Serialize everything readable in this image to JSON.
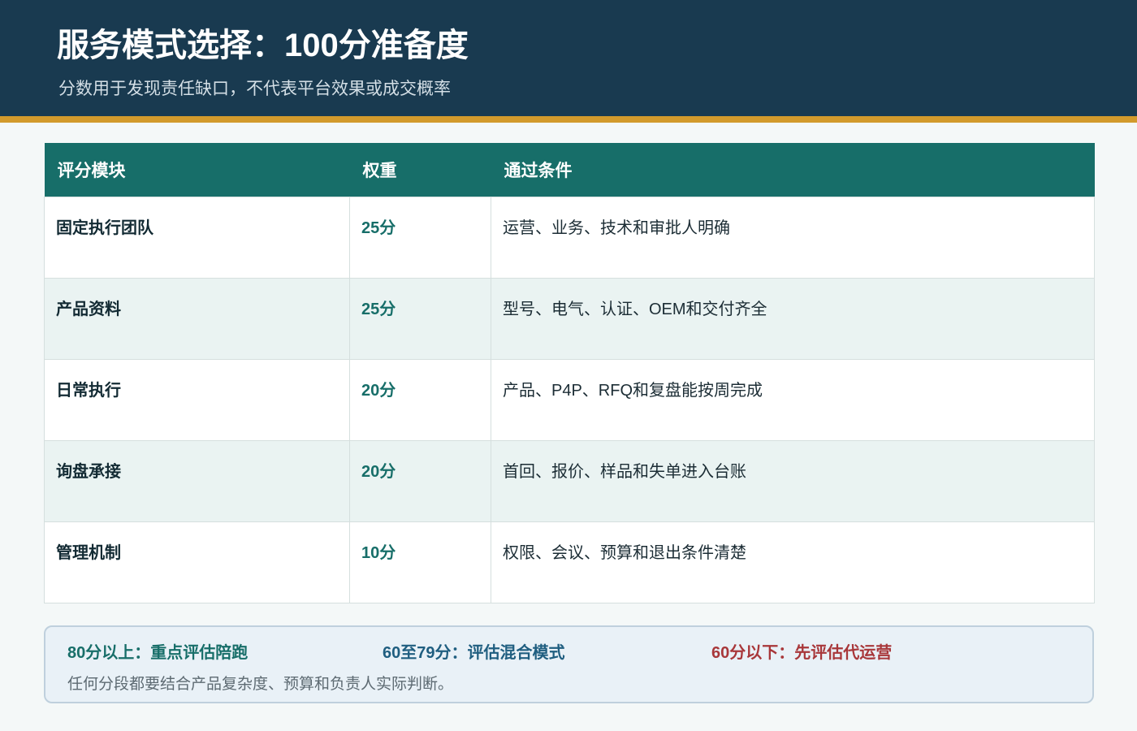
{
  "header": {
    "title": "服务模式选择：100分准备度",
    "subtitle": "分数用于发现责任缺口，不代表平台效果或成交概率"
  },
  "table": {
    "columns": [
      "评分模块",
      "权重",
      "通过条件"
    ],
    "rows": [
      {
        "module": "固定执行团队",
        "weight": "25分",
        "condition": "运营、业务、技术和审批人明确"
      },
      {
        "module": "产品资料",
        "weight": "25分",
        "condition": "型号、电气、认证、OEM和交付齐全"
      },
      {
        "module": "日常执行",
        "weight": "20分",
        "condition": "产品、P4P、RFQ和复盘能按周完成"
      },
      {
        "module": "询盘承接",
        "weight": "20分",
        "condition": "首回、报价、样品和失单进入台账"
      },
      {
        "module": "管理机制",
        "weight": "10分",
        "condition": "权限、会议、预算和退出条件清楚"
      }
    ]
  },
  "summary": {
    "high": "80分以上：重点评估陪跑",
    "mid": "60至79分：评估混合模式",
    "low": "60分以下：先评估代运营",
    "note": "任何分段都要结合产品复杂度、预算和负责人实际判断。"
  },
  "colors": {
    "header_bg": "#193a50",
    "accent": "#d29a2c",
    "table_header_bg": "#176e69",
    "high_tier": "#176e69",
    "mid_tier": "#1f5e80",
    "low_tier": "#a8373a"
  }
}
